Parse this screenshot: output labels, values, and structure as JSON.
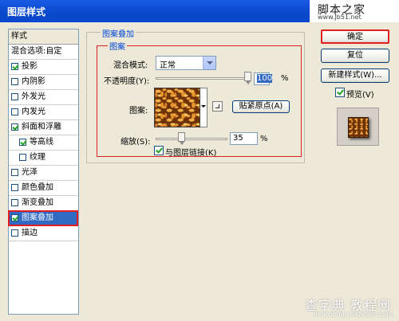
{
  "window": {
    "title": "图层样式",
    "logo_text": "脚本之家",
    "logo_url": "www.Jb51.net"
  },
  "style_list": {
    "header": "样式",
    "items": [
      {
        "label": "混合选项:自定",
        "checkbox": false,
        "checked": false,
        "indent": false,
        "selected": false
      },
      {
        "label": "投影",
        "checkbox": true,
        "checked": true,
        "indent": false,
        "selected": false
      },
      {
        "label": "内阴影",
        "checkbox": true,
        "checked": false,
        "indent": false,
        "selected": false
      },
      {
        "label": "外发光",
        "checkbox": true,
        "checked": false,
        "indent": false,
        "selected": false
      },
      {
        "label": "内发光",
        "checkbox": true,
        "checked": false,
        "indent": false,
        "selected": false
      },
      {
        "label": "斜面和浮雕",
        "checkbox": true,
        "checked": true,
        "indent": false,
        "selected": false
      },
      {
        "label": "等高线",
        "checkbox": true,
        "checked": true,
        "indent": true,
        "selected": false
      },
      {
        "label": "纹理",
        "checkbox": true,
        "checked": false,
        "indent": true,
        "selected": false
      },
      {
        "label": "光泽",
        "checkbox": true,
        "checked": false,
        "indent": false,
        "selected": false
      },
      {
        "label": "颜色叠加",
        "checkbox": true,
        "checked": false,
        "indent": false,
        "selected": false
      },
      {
        "label": "渐变叠加",
        "checkbox": true,
        "checked": false,
        "indent": false,
        "selected": false
      },
      {
        "label": "图案叠加",
        "checkbox": true,
        "checked": true,
        "indent": false,
        "selected": true
      },
      {
        "label": "描边",
        "checkbox": true,
        "checked": false,
        "indent": false,
        "selected": false
      }
    ]
  },
  "panel": {
    "group_title": "图案叠加",
    "subgroup_title": "图案",
    "blend_mode_label": "混合模式:",
    "blend_mode_value": "正常",
    "opacity_label": "不透明度(Y):",
    "opacity_value": "100",
    "opacity_fraction": 1.0,
    "opacity_unit": "%",
    "pattern_label": "图案:",
    "snap_origin_button": "贴紧原点(A)",
    "scale_label": "缩放(S):",
    "scale_value": "35",
    "scale_fraction": 0.35,
    "scale_unit": "%",
    "link_layer_label": "与图层链接(K)",
    "link_layer_checked": true
  },
  "buttons": {
    "ok": "确定",
    "reset": "复位",
    "new_style": "新建样式(W)..."
  },
  "preview": {
    "label": "预览(V)",
    "checked": true
  },
  "watermark": {
    "line1": "查字典 教程网",
    "line2": "jiaocheng.chazidian.com"
  }
}
